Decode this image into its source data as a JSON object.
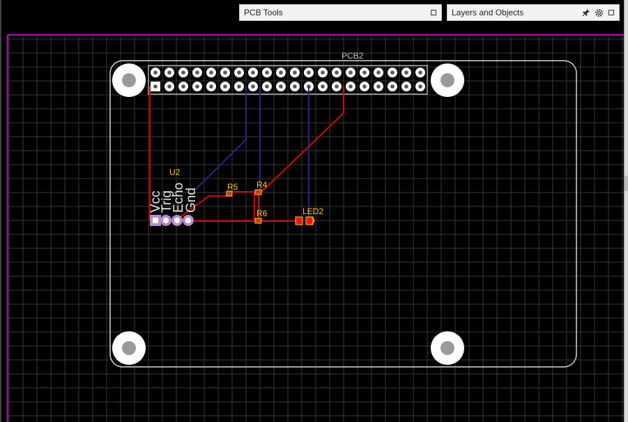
{
  "panels": {
    "pcb_tools": {
      "title": "PCB Tools"
    },
    "layers": {
      "title": "Layers and Objects"
    }
  },
  "icons": {
    "pin": "pin-icon",
    "gear": "gear-icon",
    "restore": "square-icon"
  },
  "colors": {
    "background": "#000000",
    "grid": "#3a3a3a",
    "border": "#ff00ff",
    "outline": "#d8d8d8",
    "copper_top": "#e00000",
    "copper_bottom": "#1c2a8c",
    "silk": "#ffd200",
    "label": "#c8c8c8"
  },
  "board": {
    "name": "PCB2",
    "sensor": {
      "ref": "U2",
      "pins": [
        "Vcc",
        "Trig",
        "Echo",
        "Gnd"
      ]
    },
    "resistors": [
      "R5",
      "R4",
      "R6"
    ],
    "led": "LED2"
  }
}
